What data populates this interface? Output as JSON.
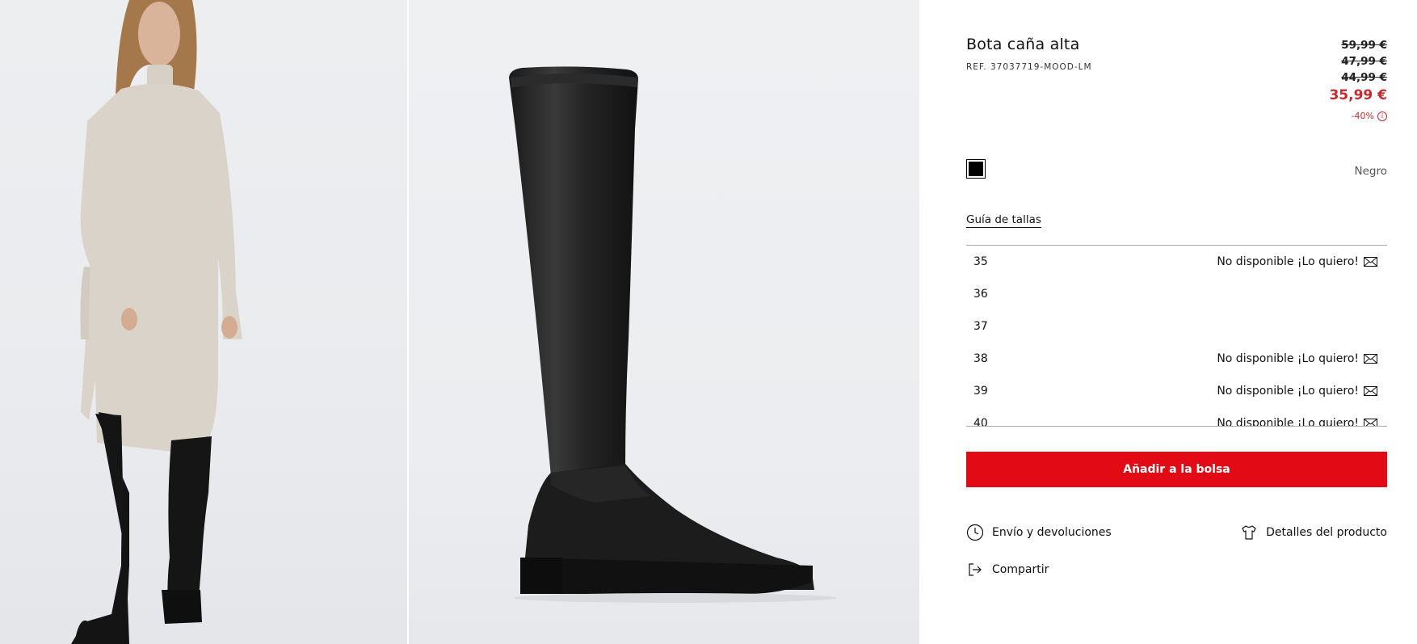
{
  "product": {
    "title": "Bota caña alta",
    "ref": "REF. 37037719-MOOD-LM",
    "prices": {
      "old": [
        "59,99 €",
        "47,99 €",
        "44,99 €"
      ],
      "current": "35,99 €",
      "discount": "-40%"
    },
    "color": {
      "name": "Negro",
      "swatch": "#000000"
    }
  },
  "size_guide_label": "Guía de tallas",
  "sizes": [
    {
      "size": "35",
      "status": "No disponible ¡Lo quiero!"
    },
    {
      "size": "36",
      "status": ""
    },
    {
      "size": "37",
      "status": ""
    },
    {
      "size": "38",
      "status": "No disponible ¡Lo quiero!"
    },
    {
      "size": "39",
      "status": "No disponible ¡Lo quiero!"
    },
    {
      "size": "40",
      "status": "No disponible ¡Lo quiero!"
    }
  ],
  "add_to_bag_label": "Añadir a la bolsa",
  "links": {
    "shipping": "Envío y devoluciones",
    "details": "Detalles del producto",
    "share": "Compartir"
  },
  "icons": {
    "info": "info-icon",
    "mail": "envelope-icon",
    "clock": "clock-icon",
    "tshirt": "tshirt-icon",
    "share": "share-icon"
  },
  "colors": {
    "accent": "#e20a14",
    "sale": "#c9282d"
  }
}
